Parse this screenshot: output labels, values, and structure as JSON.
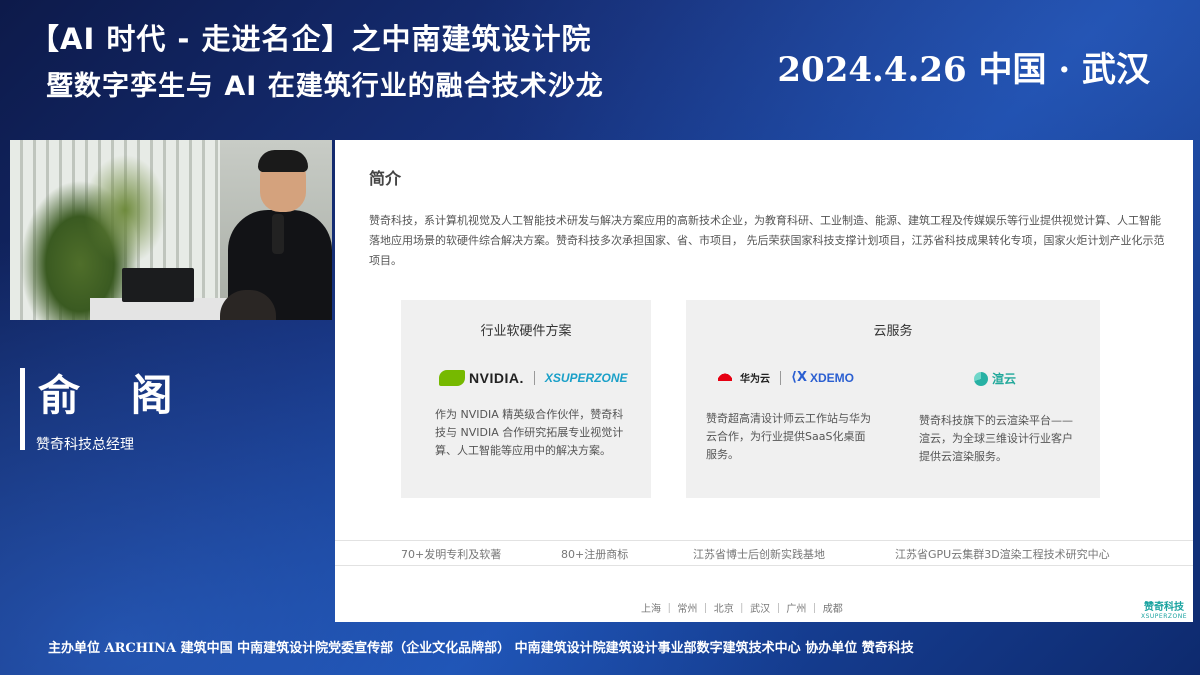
{
  "header": {
    "title_line1": "【AI 时代 - 走进名企】之中南建筑设计院",
    "title_line2": "暨数字孪生与 AI 在建筑行业的融合技术沙龙",
    "date_location": "2024.4.26  中国 · 武汉"
  },
  "speaker": {
    "name": "俞 阁",
    "role": "赞奇科技总经理"
  },
  "slide": {
    "heading": "简介",
    "intro": "赞奇科技，系计算机视觉及人工智能技术研发与解决方案应用的高新技术企业，为教育科研、工业制造、能源、建筑工程及传媒娱乐等行业提供视觉计算、人工智能落地应用场景的软硬件综合解决方案。赞奇科技多次承担国家、省、市项目， 先后荣获国家科技支撑计划项目，江苏省科技成果转化专项，国家火炬计划产业化示范项目。",
    "left_card": {
      "title": "行业软硬件方案",
      "logo1": "NVIDIA.",
      "logo2": "XSUPERZONE",
      "desc": "作为 NVIDIA 精英级合作伙伴，赞奇科技与 NVIDIA 合作研究拓展专业视觉计算、人工智能等应用中的解决方案。"
    },
    "right_card": {
      "title": "云服务",
      "huawei_logo": "华为云",
      "xdemo_logo": "XDEMO",
      "xuanyun_logo": "渲云",
      "desc1": "赞奇超高清设计师云工作站与华为云合作，为行业提供SaaS化桌面服务。",
      "desc2": "赞奇科技旗下的云渲染平台——渲云，为全球三维设计行业客户提供云渲染服务。"
    },
    "stats": [
      "70+发明专利及软著",
      "80+注册商标",
      "江苏省博士后创新实践基地",
      "江苏省GPU云集群3D渲染工程技术研究中心"
    ],
    "cities": "上海 ｜ 常州 ｜ 北京 ｜ 武汉 ｜ 广州 ｜ 成都",
    "brand_logo_cn": "赞奇科技",
    "brand_logo_en": "XSUPERZONE"
  },
  "footer": {
    "text": "主办单位   ARCHINA 建筑中国   中南建筑设计院党委宣传部（企业文化品牌部）  中南建筑设计院建筑设计事业部数字建筑技术中心    协办单位  赞奇科技"
  },
  "colors": {
    "background": "#16307a",
    "nvidia_green": "#76b900",
    "huawei_red": "#e60012",
    "xdemo_blue": "#2b5fd1",
    "xuanyun_teal": "#20a89a"
  }
}
